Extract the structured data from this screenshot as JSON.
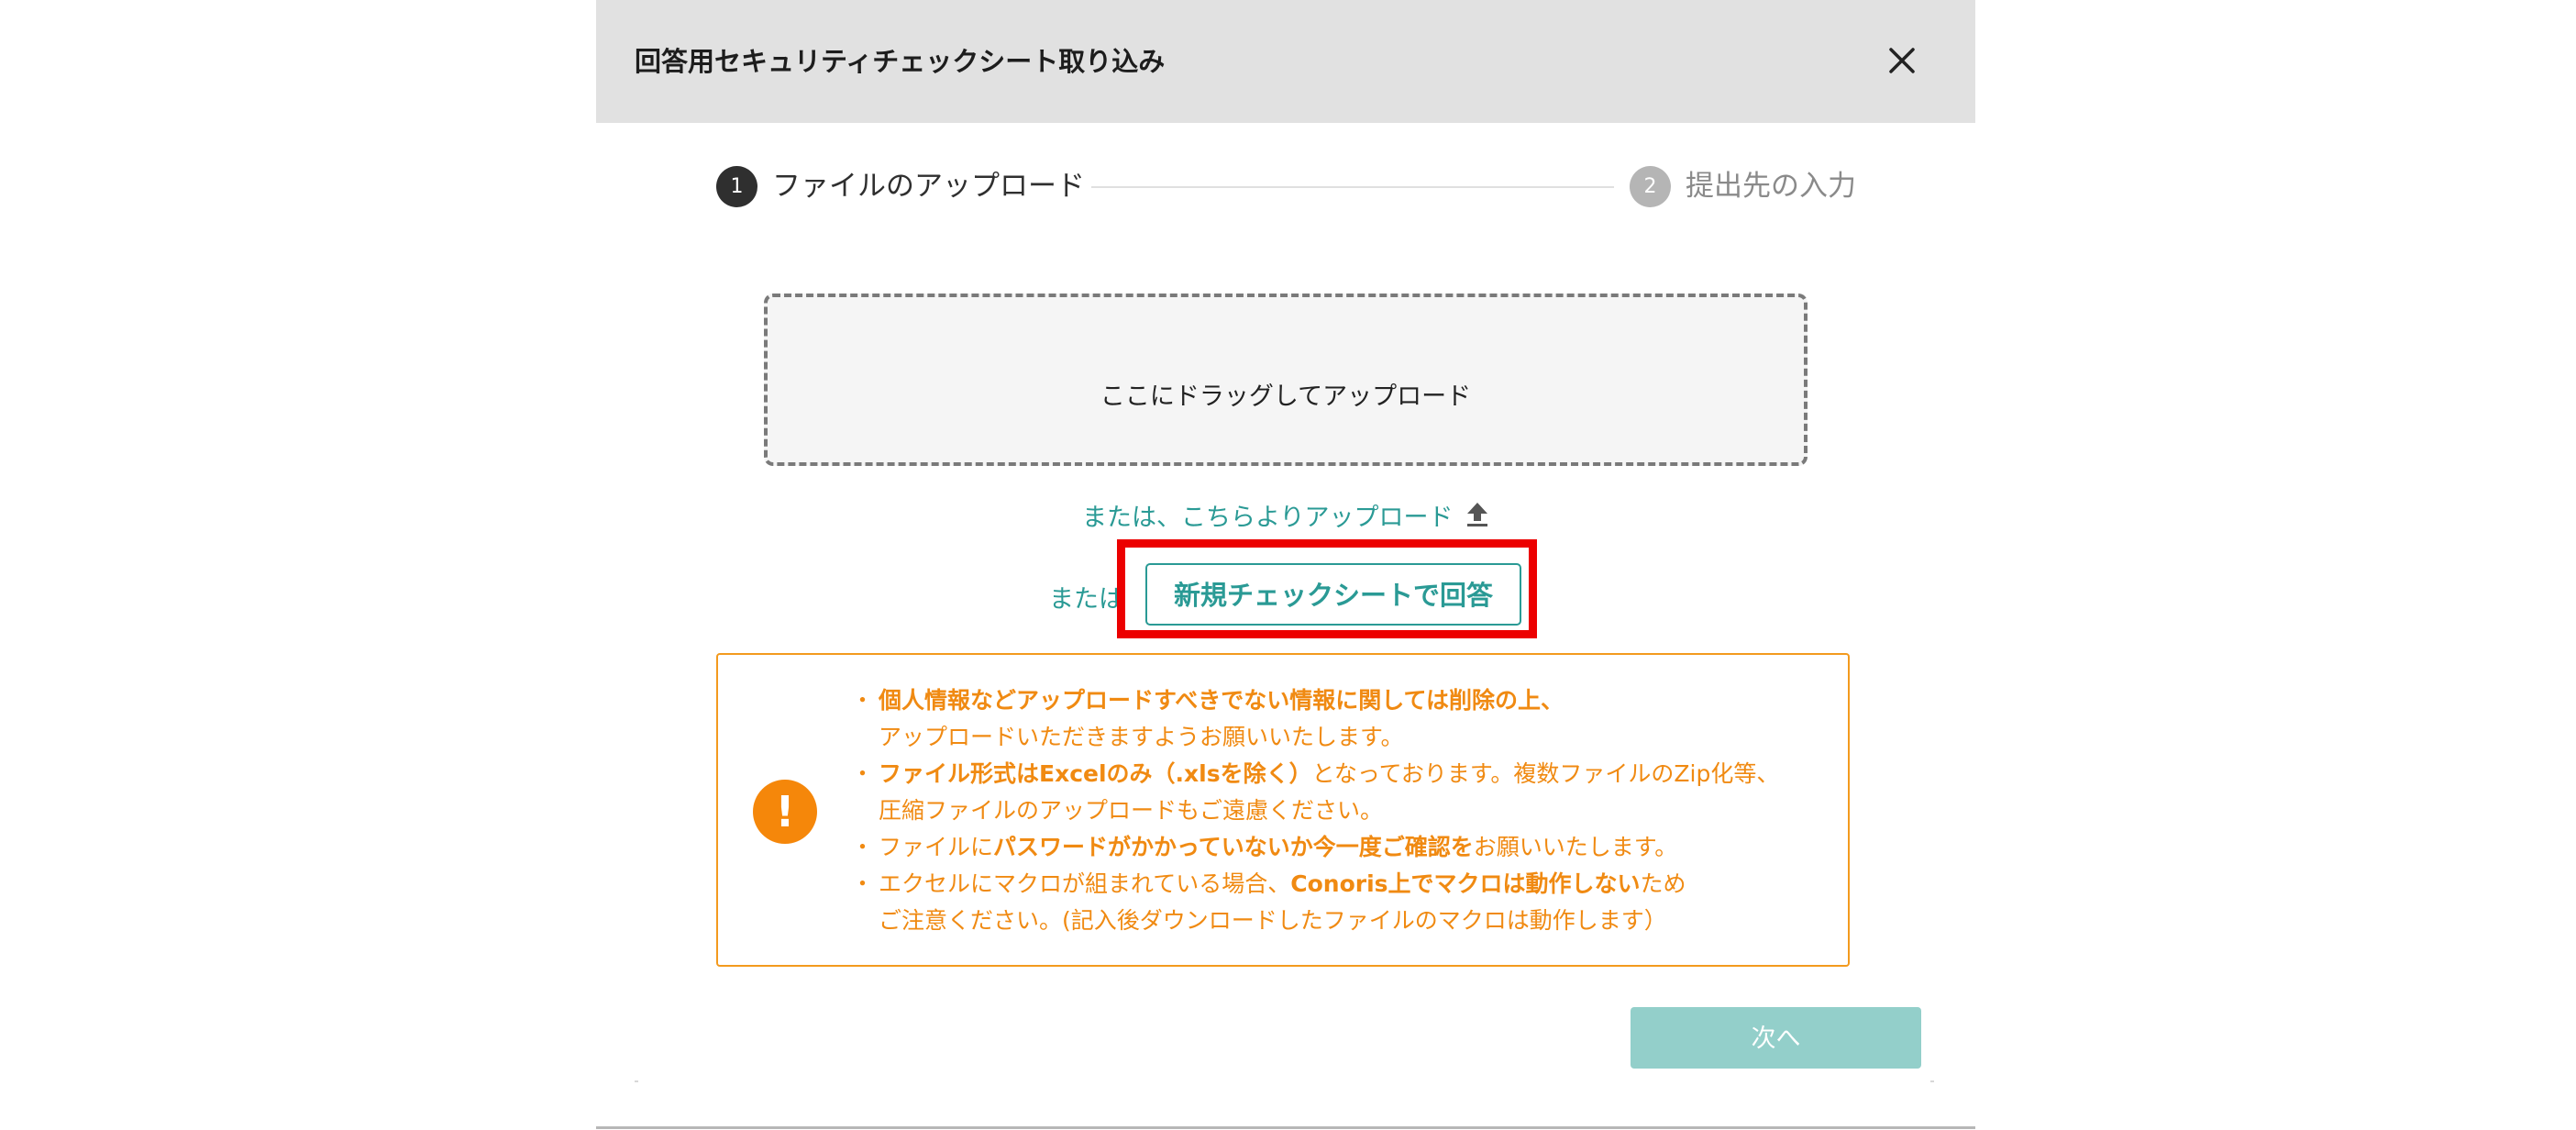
{
  "modal": {
    "title": "回答用セキュリティチェックシート取り込み"
  },
  "stepper": {
    "steps": [
      {
        "number": "1",
        "label": "ファイルのアップロード",
        "active": true
      },
      {
        "number": "2",
        "label": "提出先の入力",
        "active": false
      }
    ]
  },
  "dropzone": {
    "text": "ここにドラッグしてアップロード"
  },
  "upload_link": {
    "text": "または、こちらよりアップロード"
  },
  "alternative": {
    "or_text": "または、",
    "new_sheet_label": "新規チェックシートで回答"
  },
  "notice": {
    "items": [
      {
        "lines": [
          [
            {
              "text": "個人情報などアップロードすべきでない情報に関しては削除の上、",
              "bold": true
            }
          ],
          [
            {
              "text": "アップロードいただきますようお願いいたします。",
              "bold": false
            }
          ]
        ]
      },
      {
        "lines": [
          [
            {
              "text": "ファイル形式はExcelのみ（.xlsを除く）",
              "bold": true
            },
            {
              "text": "となっております。複数ファイルのZip化等、",
              "bold": false
            }
          ],
          [
            {
              "text": "圧縮ファイルのアップロードもご遠慮ください。",
              "bold": false
            }
          ]
        ]
      },
      {
        "lines": [
          [
            {
              "text": "ファイルに",
              "bold": false
            },
            {
              "text": "パスワードがかかっていないか今一度ご確認を",
              "bold": true
            },
            {
              "text": "お願いいたします。",
              "bold": false
            }
          ]
        ]
      },
      {
        "lines": [
          [
            {
              "text": "エクセルにマクロが組まれている場合、",
              "bold": false
            },
            {
              "text": "Conoris上でマクロは動作しない",
              "bold": true
            },
            {
              "text": "ため",
              "bold": false
            }
          ],
          [
            {
              "text": "ご注意ください。(記入後ダウンロードしたファイルのマクロは動作します）",
              "bold": false
            }
          ]
        ]
      }
    ]
  },
  "footer": {
    "next_label": "次へ"
  },
  "colors": {
    "accent": "#2a9a95",
    "warning": "#f08a12",
    "highlight": "#ec0000",
    "next_disabled": "#93cfca"
  }
}
